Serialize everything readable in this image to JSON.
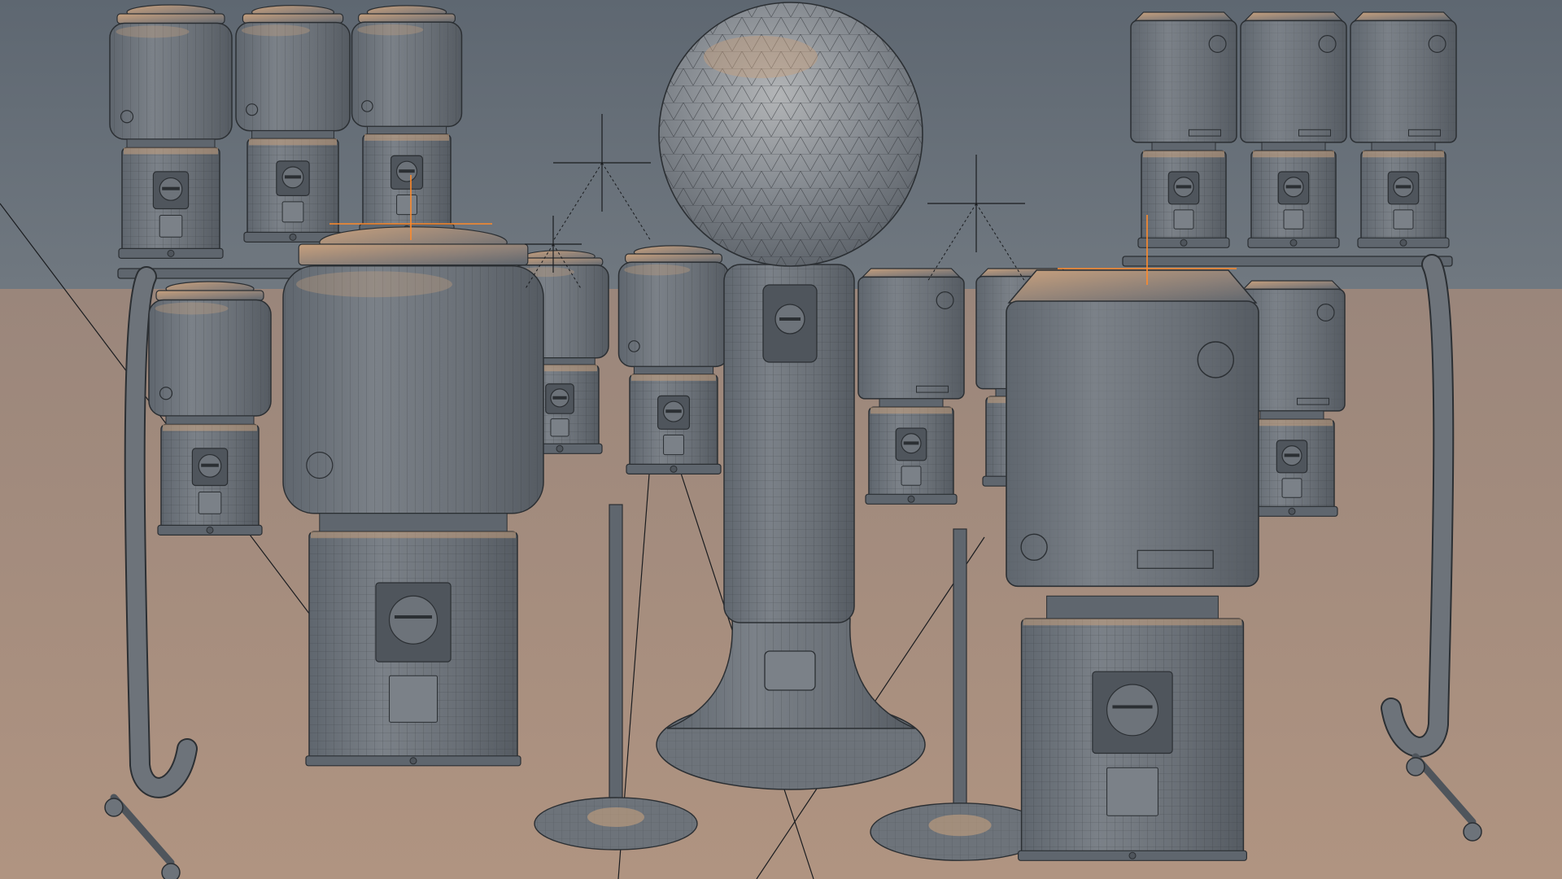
{
  "viewport": {
    "mode": "3d-viewport-wireframe-overlay",
    "colors": {
      "background_wall": "#68717a",
      "floor": "#a88f7f",
      "mesh_body": "#6d737a",
      "mesh_light": "#c7a07d",
      "wire": "#2b2f33",
      "selection_origin": "#ff8a2a",
      "empty_lines": "#1a1c1f"
    }
  },
  "objects": [
    {
      "name": "gumball-machine-cylinder",
      "kind": "cylinder",
      "count": 8
    },
    {
      "name": "gumball-machine-square",
      "kind": "square",
      "count": 8
    },
    {
      "name": "gumball-machine-globe-tower",
      "kind": "globe-tower",
      "count": 1
    },
    {
      "name": "stand-pole",
      "kind": "stand",
      "count": 2
    },
    {
      "name": "stand-rack",
      "kind": "rack",
      "count": 2
    }
  ]
}
